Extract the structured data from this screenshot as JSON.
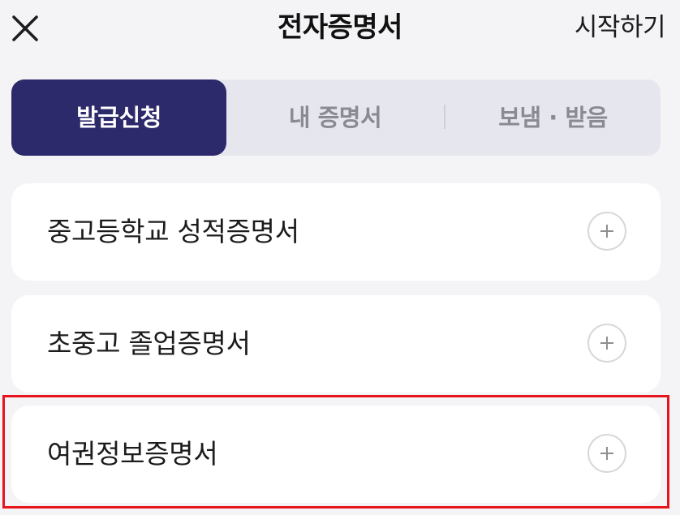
{
  "header": {
    "close_icon": "close-icon",
    "title": "전자증명서",
    "start_label": "시작하기"
  },
  "tabs": [
    {
      "label": "발급신청",
      "active": true
    },
    {
      "label": "내 증명서",
      "active": false
    },
    {
      "label": "보냄 · 받음",
      "active": false
    }
  ],
  "certificates": [
    {
      "label": "중고등학교 성적증명서",
      "icon": "plus-circle-icon"
    },
    {
      "label": "초중고 졸업증명서",
      "icon": "plus-circle-icon"
    },
    {
      "label": "여권정보증명서",
      "icon": "plus-circle-icon"
    }
  ],
  "colors": {
    "accent": "#2d2a6b",
    "highlight": "#e8141c",
    "background": "#f4f4f6"
  }
}
